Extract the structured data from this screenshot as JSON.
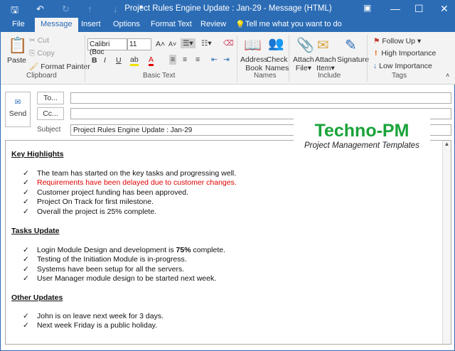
{
  "window": {
    "title": "Project Rules Engine Update : Jan-29  - Message (HTML)"
  },
  "tabs": [
    {
      "label": "File"
    },
    {
      "label": "Message"
    },
    {
      "label": "Insert"
    },
    {
      "label": "Options"
    },
    {
      "label": "Format Text"
    },
    {
      "label": "Review"
    }
  ],
  "tell_me": "Tell me what you want to do",
  "ribbon": {
    "clipboard": {
      "paste": "Paste",
      "cut": "Cut",
      "copy": "Copy",
      "format_painter": "Format Painter",
      "label": "Clipboard"
    },
    "basic_text": {
      "font": "Calibri (Boc",
      "size": "11",
      "label": "Basic Text",
      "bold": "B",
      "italic": "I",
      "underline": "U"
    },
    "names": {
      "address_book": "Address",
      "address_book2": "Book",
      "check_names": "Check",
      "check_names2": "Names",
      "label": "Names"
    },
    "include": {
      "attach_file": "Attach",
      "attach_file2": "File",
      "attach_item": "Attach",
      "attach_item2": "Item",
      "signature": "Signature",
      "label": "Include"
    },
    "tags": {
      "follow_up": "Follow Up",
      "high": "High Importance",
      "low": "Low Importance",
      "label": "Tags"
    }
  },
  "compose": {
    "send": "Send",
    "to": "To...",
    "cc": "Cc...",
    "subject_label": "Subject",
    "to_value": "",
    "cc_value": "",
    "subject_value": "Project Rules Engine Update : Jan-29"
  },
  "logo": {
    "title": "Techno-PM",
    "subtitle": "Project Management Templates"
  },
  "message": {
    "sections": [
      {
        "heading": "Key Highlights",
        "items": [
          {
            "text": "The team has started on the key tasks and progressing well.",
            "color": "#111111"
          },
          {
            "text": "Requirements have been delayed due to customer changes.",
            "color": "#e00000"
          },
          {
            "text": "Customer project funding has been approved.",
            "color": "#111111"
          },
          {
            "text": "Project On Track for first milestone.",
            "color": "#111111"
          },
          {
            "text": "Overall the project is 25% complete.",
            "color": "#111111"
          }
        ]
      },
      {
        "heading": "Tasks Update",
        "items": [
          {
            "text_before": "Login Module Design and development is ",
            "bold": "75%",
            "text_after": " complete."
          },
          {
            "text": "Testing of the Initiation Module is in-progress."
          },
          {
            "text": "Systems have been setup for all the servers."
          },
          {
            "text": "User Manager module design to be started next week."
          }
        ]
      },
      {
        "heading": "Other Updates",
        "items": [
          {
            "text": "John is on leave next week for 3 days."
          },
          {
            "text": "Next week Friday is a public holiday."
          }
        ]
      }
    ]
  },
  "check_glyph": "✓"
}
